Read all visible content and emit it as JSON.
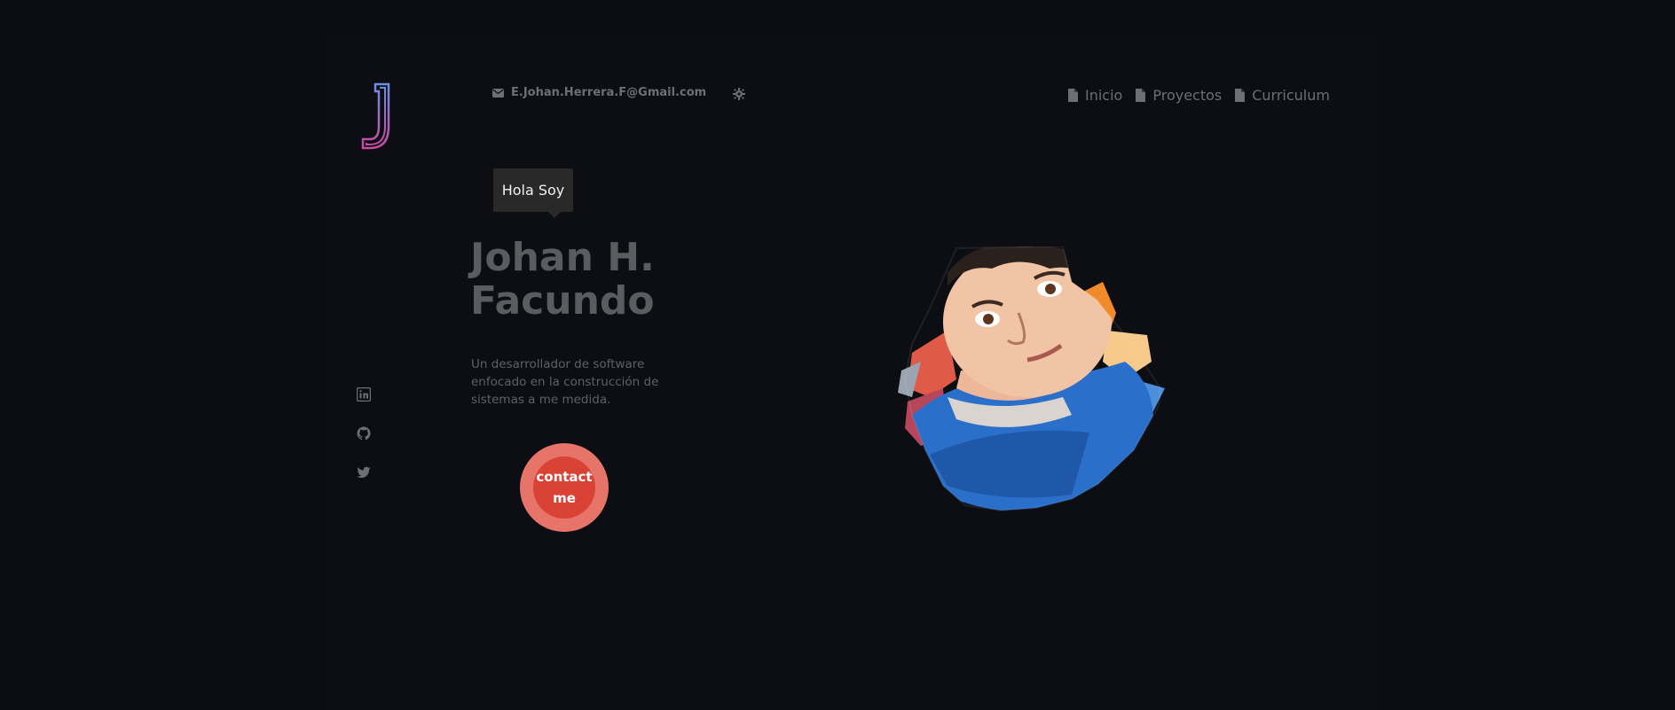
{
  "header": {
    "email": "E.Johan.Herrera.F@Gmail.com",
    "nav": [
      {
        "label": "Inicio",
        "icon": "file-icon"
      },
      {
        "label": "Proyectos",
        "icon": "file-icon"
      },
      {
        "label": "Curriculum",
        "icon": "file-icon"
      }
    ]
  },
  "hero": {
    "greeting": "Hola Soy",
    "name_line1": "Johan H.",
    "name_line2": "Facundo",
    "description": "Un desarrollador de software enfocado en la construcción de sistemas a me medida.",
    "contact_line1": "contact",
    "contact_line2": "me"
  },
  "socials": [
    {
      "icon": "linkedin-icon"
    },
    {
      "icon": "github-icon"
    },
    {
      "icon": "twitter-icon"
    }
  ],
  "colors": {
    "background": "#0b0d12",
    "text_muted": "#6c6f76",
    "button_outer": "#e77468",
    "button_inner": "#da4236",
    "tooltip_bg": "#2a2929",
    "logo_gradient_top": "#6f8ee6",
    "logo_gradient_bottom": "#c64aa0"
  }
}
